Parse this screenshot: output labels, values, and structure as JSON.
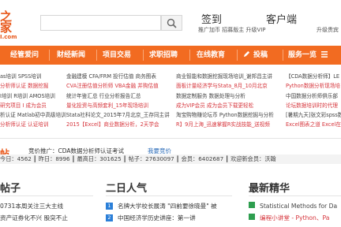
{
  "header": {
    "logo_text": "之家",
    "logo_sub": "I.com",
    "search_placeholder": "",
    "signin_label": "签到",
    "client_label": "客户端",
    "signin_sub": "推广加币 招募版主 升级VIP",
    "client_sub": "升级贵宾"
  },
  "nav": {
    "items": [
      "经管爱问",
      "财经新闻",
      "项目交易",
      "求职招聘",
      "在线教育",
      "投稿",
      "服务一览"
    ]
  },
  "links": {
    "col1": [
      {
        "text": "as培训  SPSS培训",
        "style": "blk"
      },
      {
        "text": "分析师认证  数据挖掘",
        "style": "red"
      },
      {
        "text": "Ⅰ培训  R培训  AMOS培训",
        "style": "blk"
      },
      {
        "text": "研究项目  Ⅰ 成为会员",
        "style": "red"
      },
      {
        "text": "析认证  Matlab初中高级培训",
        "style": "blk"
      },
      {
        "text": "分析师认证  认证培训",
        "style": "red"
      }
    ],
    "col2": [
      {
        "text": "金融建模  CFA/FRM  投行估值  商务图表",
        "style": "blk"
      },
      {
        "text": "CVA注册估值分析师  VBA金融  并购估值",
        "style": "red"
      },
      {
        "text": "统计年鉴汇总  行业分析报告汇总",
        "style": "blk"
      },
      {
        "text": "量化投资与高频套利_15年现场培训",
        "style": "red"
      },
      {
        "text": "Stata社科论文_2015年7月北京_王存同主讲",
        "style": "blk"
      },
      {
        "text": "2015【Excel】商业数据分析，2天学会",
        "style": "red"
      }
    ],
    "col3": [
      {
        "text": "商业智能和数据挖掘现场培训_谢邦昌主讲",
        "style": "blk"
      },
      {
        "text": "面板计量经济学与Stata_8月_10月北京",
        "style": "red"
      },
      {
        "text": "数据定制服务  数据处理与分析",
        "style": "blk"
      },
      {
        "text": "成为VIP会员  成为会员下载更轻松",
        "style": "red"
      },
      {
        "text": "淘宝购物赚论坛币  Python数据挖掘与分析",
        "style": "blk"
      },
      {
        "text": "R】9月上海_迅速掌握R实战技能_送视频",
        "style": "red"
      }
    ],
    "col4": [
      {
        "text": "【CDA数据分析师】LE",
        "style": "blk"
      },
      {
        "text": "Python数据分析现场培",
        "style": "red"
      },
      {
        "text": "中国数据分析师俱乐部",
        "style": "blk"
      },
      {
        "text": "论坛数据培训时的代理",
        "style": "red"
      },
      {
        "text": "[暑期九天]张文彩spss数",
        "style": "blk"
      },
      {
        "text": "Excel图表之道  Excel在",
        "style": "red"
      }
    ]
  },
  "promo": {
    "icon_text": "帖",
    "text": "竞价推广：CDA数据分析师认证考试",
    "link": "我要竞价"
  },
  "stats": {
    "text": "今日：4562 ┃ 昨日：8996 ┃ 最高日：301625 ┃ 帖子：27630097 ┃ 会员：6402687 ┃ 欢迎新会员：沃翰"
  },
  "sections": {
    "col1": {
      "title": "帖子",
      "rows": [
        "0731本周关注三大主线",
        "资产证券化不兴 股突不止"
      ]
    },
    "col2": {
      "title": "二日人气",
      "rows": [
        {
          "num": "1",
          "text": "名牌大学校长展涛 \"四前要徐晓曼\" 被"
        },
        {
          "num": "2",
          "text": "中国经济学历史讲座：第一讲"
        }
      ]
    },
    "col3": {
      "title": "最新精华",
      "rows": [
        {
          "text": "Statistical Methods for Da",
          "style": "blk"
        },
        {
          "text": "编程小讲堂 - Python、Pa",
          "style": "red"
        }
      ]
    }
  },
  "colors": {
    "nav_bg": "#f26b21",
    "accent_red": "#d6343b",
    "link_blue": "#2a6bb8",
    "badge_blue": "#2b7fd8",
    "square_green": "#2e9e4f"
  }
}
